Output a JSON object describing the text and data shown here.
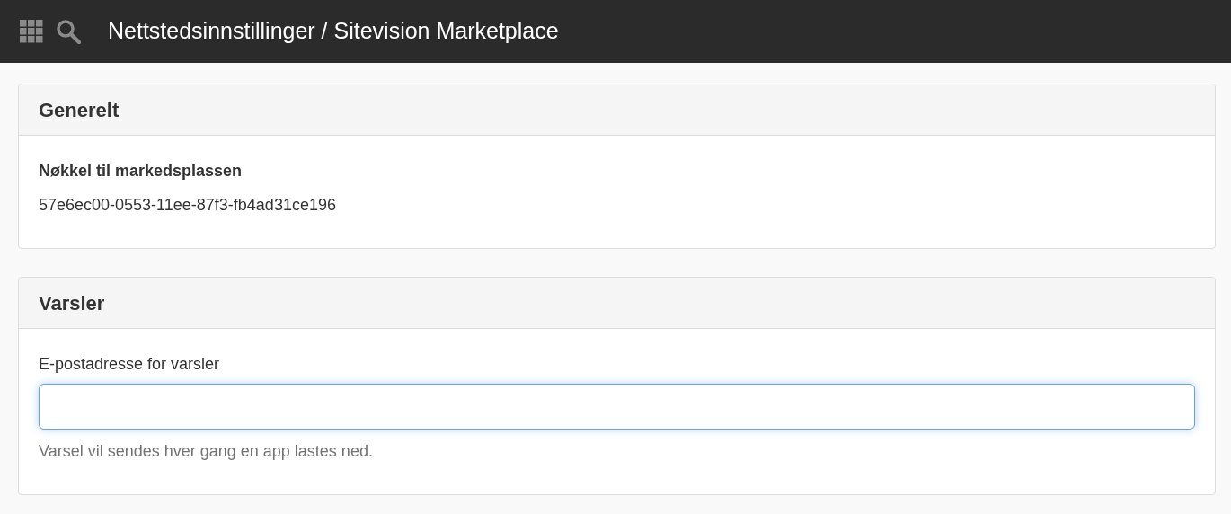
{
  "header": {
    "title": "Nettstedsinnstillinger / Sitevision Marketplace"
  },
  "panels": [
    {
      "title": "Generelt",
      "fields": [
        {
          "kind": "readonly",
          "label": "Nøkkel til markedsplassen",
          "value": "57e6ec00-0553-11ee-87f3-fb4ad31ce196"
        }
      ]
    },
    {
      "title": "Varsler",
      "fields": [
        {
          "kind": "input",
          "label": "E-postadresse for varsler",
          "focused": true,
          "help": "Varsel vil sendes hver gang en app lastes ned."
        }
      ]
    }
  ]
}
